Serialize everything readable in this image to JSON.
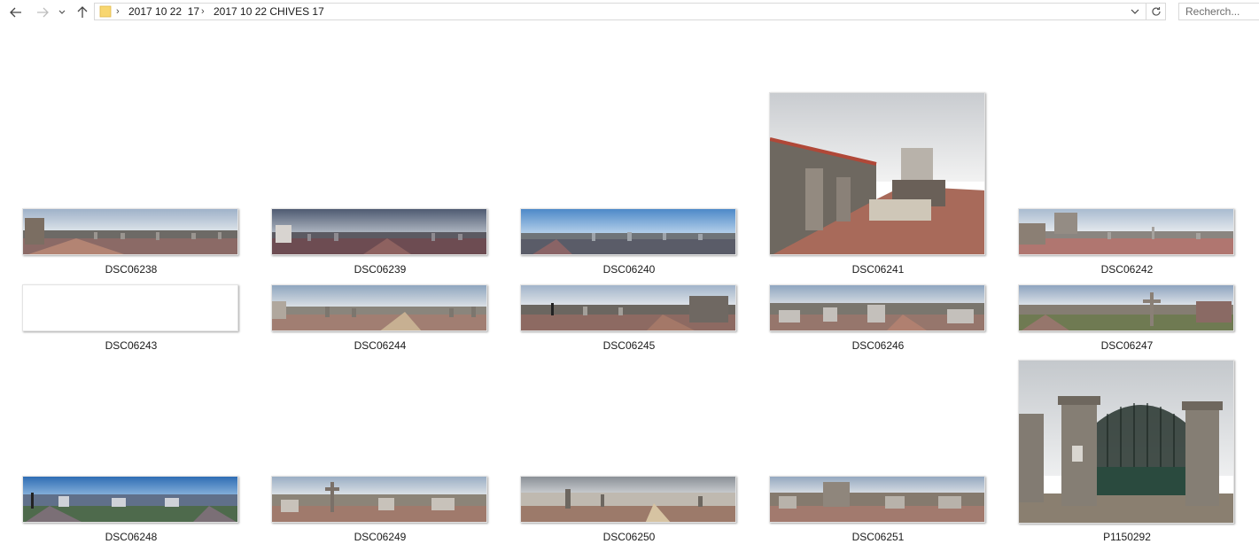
{
  "navigation": {
    "back_icon": "arrow-left-icon",
    "forward_icon": "arrow-right-icon",
    "recent_icon": "chevron-down-icon",
    "up_icon": "arrow-up-icon"
  },
  "address_bar": {
    "breadcrumbs": [
      "2017 10 22  17",
      "2017 10 22 CHIVES 17"
    ],
    "folder_icon": "folder-icon",
    "dropdown_icon": "chevron-down-icon",
    "refresh_icon": "refresh-icon"
  },
  "search": {
    "placeholder": "Recherch..."
  },
  "files": [
    {
      "name": "DSC06238",
      "kind": "panorama"
    },
    {
      "name": "DSC06239",
      "kind": "panorama"
    },
    {
      "name": "DSC06240",
      "kind": "panorama"
    },
    {
      "name": "DSC06241",
      "kind": "photo"
    },
    {
      "name": "DSC06242",
      "kind": "panorama"
    },
    {
      "name": "DSC06243",
      "kind": "blank"
    },
    {
      "name": "DSC06244",
      "kind": "panorama"
    },
    {
      "name": "DSC06245",
      "kind": "panorama"
    },
    {
      "name": "DSC06246",
      "kind": "panorama"
    },
    {
      "name": "DSC06247",
      "kind": "panorama"
    },
    {
      "name": "DSC06248",
      "kind": "panorama"
    },
    {
      "name": "DSC06249",
      "kind": "panorama"
    },
    {
      "name": "DSC06250",
      "kind": "panorama"
    },
    {
      "name": "DSC06251",
      "kind": "panorama"
    },
    {
      "name": "P1150292",
      "kind": "photo"
    }
  ]
}
